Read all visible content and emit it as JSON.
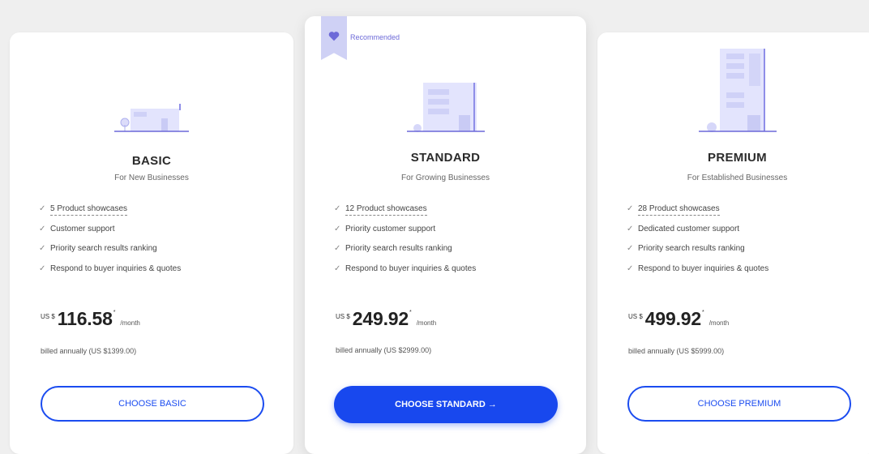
{
  "colors": {
    "accent": "#1848ee",
    "ribbon": "#cfd1f5",
    "illustration": "#d9dafc"
  },
  "recommended_label": "Recommended",
  "plans": [
    {
      "name": "BASIC",
      "subtitle": "For New Businesses",
      "features": [
        "5 Product showcases",
        "Customer support",
        "Priority search results ranking",
        "Respond to buyer inquiries & quotes"
      ],
      "currency": "US $",
      "price": "116.58",
      "asterisk": "*",
      "per": "/month",
      "billed": "billed annually (US $1399.00)",
      "button": "CHOOSE BASIC"
    },
    {
      "name": "STANDARD",
      "subtitle": "For Growing Businesses",
      "features": [
        "12 Product showcases",
        "Priority customer support",
        "Priority search results ranking",
        "Respond to buyer inquiries & quotes"
      ],
      "currency": "US $",
      "price": "249.92",
      "asterisk": "*",
      "per": "/month",
      "billed": "billed annually (US $2999.00)",
      "button": "CHOOSE STANDARD →"
    },
    {
      "name": "PREMIUM",
      "subtitle": "For Established Businesses",
      "features": [
        "28 Product showcases",
        "Dedicated customer support",
        "Priority search results ranking",
        "Respond to buyer inquiries & quotes"
      ],
      "currency": "US $",
      "price": "499.92",
      "asterisk": "*",
      "per": "/month",
      "billed": "billed annually (US $5999.00)",
      "button": "CHOOSE PREMIUM"
    }
  ]
}
